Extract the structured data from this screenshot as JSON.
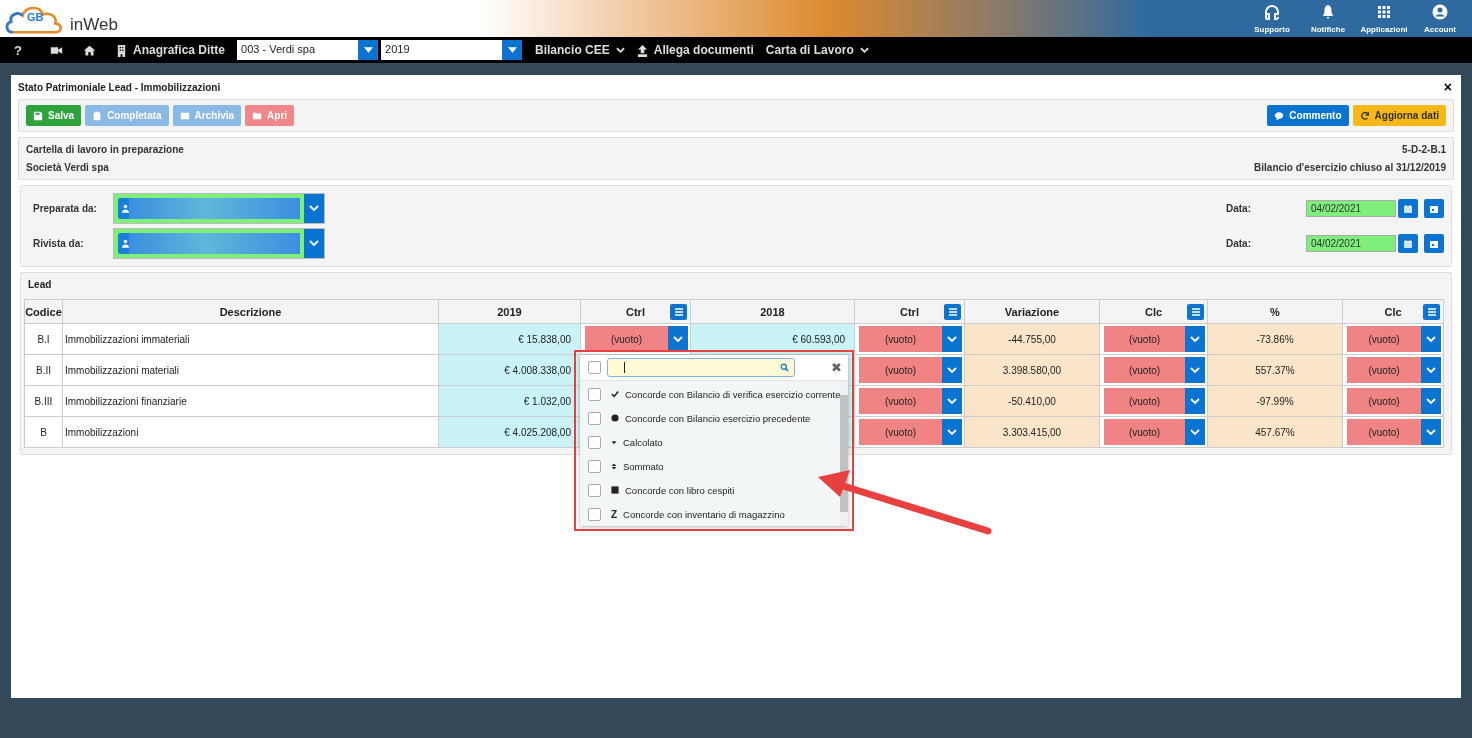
{
  "header": {
    "logo_mark": "GB",
    "logo_text": "inWeb",
    "actions": [
      {
        "label": "Supporto"
      },
      {
        "label": "Notifiche"
      },
      {
        "label": "Applicazioni"
      },
      {
        "label": "Account"
      }
    ]
  },
  "nav": [
    {
      "kind": "glyph",
      "text": "?"
    },
    {
      "kind": "camera"
    },
    {
      "kind": "home"
    },
    {
      "kind": "registry",
      "text": "Anagrafica Ditte"
    },
    {
      "kind": "select",
      "text": "003 - Verdi spa"
    },
    {
      "kind": "select",
      "text": "2019"
    },
    {
      "kind": "menu",
      "text": "Bilancio CEE"
    },
    {
      "kind": "attach",
      "text": "Allega documenti"
    },
    {
      "kind": "menu",
      "text": "Carta di Lavoro"
    }
  ],
  "panel": {
    "title": "Stato Patrimoniale Lead - Immobilizzazioni",
    "close": "×"
  },
  "toolbar": {
    "left": [
      {
        "label": "Salva",
        "disabled": false
      },
      {
        "label": "Completata",
        "disabled": true
      },
      {
        "label": "Archivia",
        "disabled": true
      },
      {
        "label": "Apri",
        "disabled": true
      }
    ],
    "right": [
      {
        "label": "Commento",
        "disabled": false
      },
      {
        "label": "Aggiorna dati",
        "disabled": false
      }
    ]
  },
  "info": {
    "left": [
      "Cartella di lavoro in preparazione",
      "Società Verdi spa"
    ],
    "right": [
      "5-D-2-B.1",
      "Bilancio d'esercizio chiuso al 31/12/2019"
    ]
  },
  "signers": [
    {
      "label": "Preparata da:",
      "date_label": "Data:",
      "date": "04/02/2021"
    },
    {
      "label": "Rivista da:",
      "date_label": "Data:",
      "date": "04/02/2021"
    }
  ],
  "lead": {
    "title": "Lead",
    "columns": [
      {
        "label": "Codice",
        "kind": "code",
        "menu": false
      },
      {
        "label": "Descrizione",
        "kind": "text",
        "menu": false
      },
      {
        "label": "2019",
        "kind": "amount",
        "menu": false
      },
      {
        "label": "Ctrl",
        "kind": "select",
        "menu": true
      },
      {
        "label": "2018",
        "kind": "amount",
        "menu": false
      },
      {
        "label": "Ctrl",
        "kind": "select",
        "menu": true
      },
      {
        "label": "Variazione",
        "kind": "diff",
        "menu": false
      },
      {
        "label": "Clc",
        "kind": "select",
        "menu": true
      },
      {
        "label": "%",
        "kind": "diff",
        "menu": false
      },
      {
        "label": "Clc",
        "kind": "select",
        "menu": true
      }
    ],
    "rows": [
      {
        "cells": [
          "B.I",
          "Immobilizzazioni immateriali",
          "€ 15.838,00",
          "(vuoto)",
          "€ 60.593,00",
          "(vuoto)",
          "-44.755,00",
          "(vuoto)",
          "-73.86%",
          "(vuoto)"
        ]
      },
      {
        "cells": [
          "B.II",
          "Immobilizzazioni materiali",
          "€ 4.008.338,00",
          null,
          null,
          "(vuoto)",
          "3.398.580,00",
          "(vuoto)",
          "557.37%",
          "(vuoto)"
        ]
      },
      {
        "cells": [
          "B.III",
          "Immobilizzazioni finanziarie",
          "€ 1.032,00",
          null,
          null,
          "(vuoto)",
          "-50.410,00",
          "(vuoto)",
          "-97.99%",
          "(vuoto)"
        ]
      },
      {
        "cells": [
          "B",
          "Immobilizzazioni",
          "€ 4.025.208,00",
          null,
          null,
          "(vuoto)",
          "3.303.415,00",
          "(vuoto)",
          "457.67%",
          "(vuoto)"
        ]
      }
    ]
  },
  "dropdown": {
    "all_checked": false,
    "close": "✖",
    "options": [
      {
        "label": "Concorde con Bilancio di verifica esercizio corrente",
        "kind": "check",
        "checked": false
      },
      {
        "label": "Concorde con Bilancio esercizio precedente",
        "kind": "circle",
        "checked": false
      },
      {
        "label": "Calcolato",
        "kind": "caret",
        "checked": false
      },
      {
        "label": "Sommato",
        "kind": "sort",
        "checked": false
      },
      {
        "label": "Concorde con libro cespiti",
        "kind": "square",
        "checked": false
      },
      {
        "label": "Concorde con inventario di magazzino",
        "kind": "letter",
        "glyph": "Z",
        "checked": false
      }
    ]
  }
}
